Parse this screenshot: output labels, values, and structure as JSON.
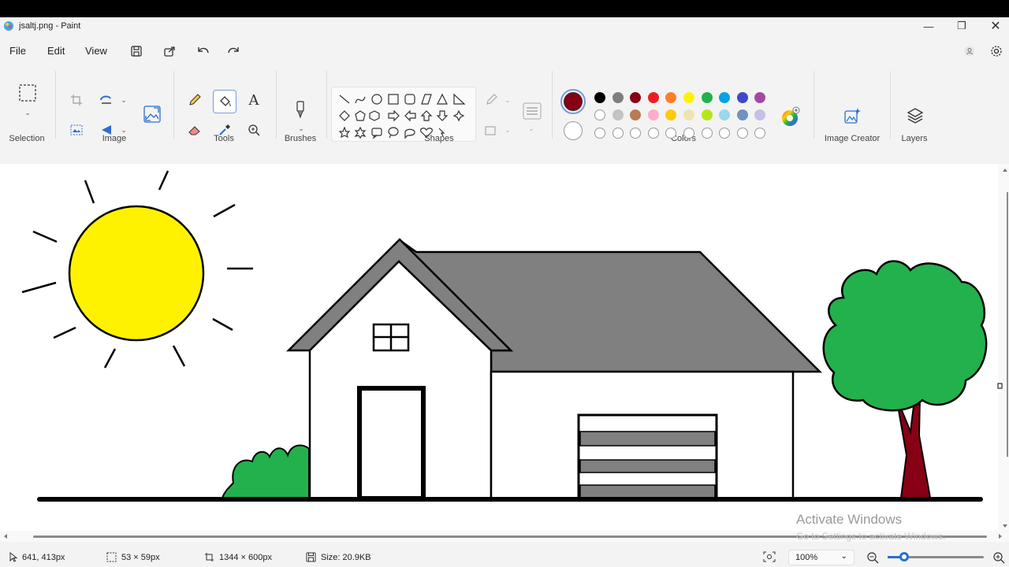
{
  "window": {
    "title": "jsaltj.png - Paint"
  },
  "menu": {
    "file": "File",
    "edit": "Edit",
    "view": "View"
  },
  "ribbon": {
    "groups": {
      "selection": "Selection",
      "image": "Image",
      "tools": "Tools",
      "brushes": "Brushes",
      "shapes": "Shapes",
      "colors": "Colors",
      "image_creator": "Image Creator",
      "layers": "Layers"
    },
    "primary_color": "#880015",
    "secondary_color": "#ffffff",
    "palette_row1": [
      "#000000",
      "#7f7f7f",
      "#880015",
      "#ed1c24",
      "#ff7f27",
      "#fff200",
      "#22b14c",
      "#00a2e8",
      "#3f48cc",
      "#a349a4"
    ],
    "palette_row2": [
      "#ffffff",
      "#c3c3c3",
      "#b97a57",
      "#ffaec9",
      "#ffc90e",
      "#efe4b0",
      "#b5e61d",
      "#99d9ea",
      "#7092be",
      "#c8bfe7"
    ]
  },
  "status": {
    "cursor": "641, 413px",
    "selection": "53 × 59px",
    "canvas_size": "1344 × 600px",
    "file_size": "Size: 20.9KB",
    "zoom": "100%"
  },
  "watermark": {
    "line1": "Activate Windows",
    "line2": "Go to Settings to activate Windows."
  },
  "drawing": {
    "sun_color": "#fff200",
    "roof_color": "#808080",
    "tree_color": "#22b14c",
    "trunk_color": "#880015",
    "bush_color": "#22b14c"
  }
}
